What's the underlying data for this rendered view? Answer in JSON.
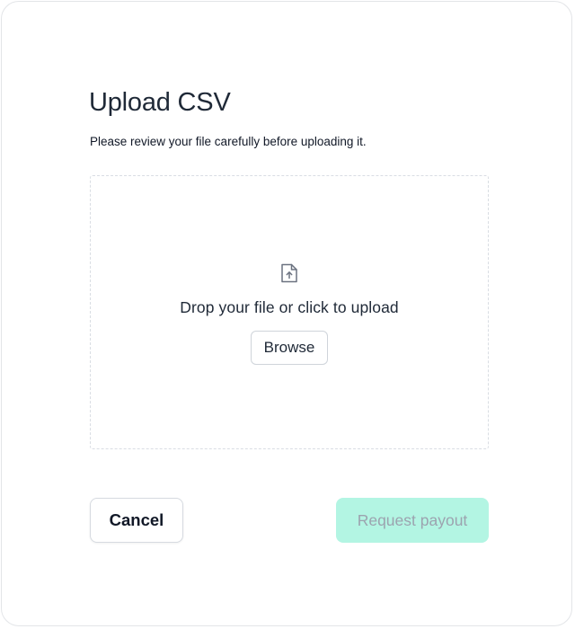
{
  "dialog": {
    "title": "Upload CSV",
    "subtitle": "Please review your file carefully before uploading it."
  },
  "dropzone": {
    "icon": "file-upload-icon",
    "prompt": "Drop your file or click to upload",
    "browse_label": "Browse"
  },
  "actions": {
    "cancel_label": "Cancel",
    "submit_label": "Request payout",
    "submit_disabled": true
  },
  "colors": {
    "submit_background": "#b3f5e3",
    "submit_text": "#9ca3af",
    "text_primary": "#1f2937",
    "border": "#d9dde3"
  }
}
